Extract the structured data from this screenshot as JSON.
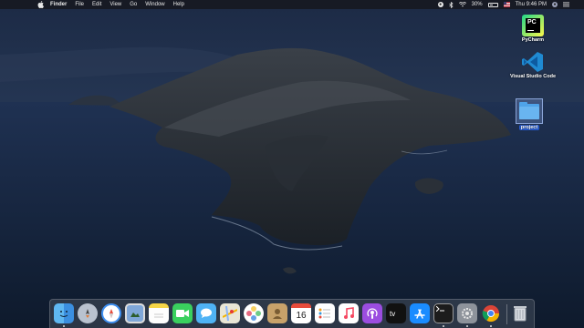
{
  "menubar": {
    "apple_icon": "apple-logo-icon",
    "app_name": "Finder",
    "menus": [
      "File",
      "Edit",
      "View",
      "Go",
      "Window",
      "Help"
    ],
    "status": {
      "battery_percent": "30%",
      "clock": "Thu 9:46 PM"
    }
  },
  "desktop_icons": [
    {
      "label": "PyCharm",
      "icon": "pycharm-icon"
    },
    {
      "label": "Visual Studio Code",
      "icon": "vscode-icon"
    },
    {
      "label": "project",
      "icon": "folder-icon"
    }
  ],
  "pycharm_glyph": "PC",
  "dock": {
    "calendar_day": "16",
    "apps": [
      "Finder",
      "Launchpad",
      "Safari",
      "Preview",
      "Notes",
      "FaceTime",
      "Messages",
      "Maps",
      "Photos",
      "Contacts",
      "Calendar",
      "Reminders",
      "Music",
      "Podcasts",
      "TV",
      "App Store",
      "Terminal",
      "System Preferences",
      "Chrome",
      "Trash"
    ]
  },
  "colors": {
    "menubar_bg": "#16181e",
    "selection_blue": "#2a5fd6"
  }
}
